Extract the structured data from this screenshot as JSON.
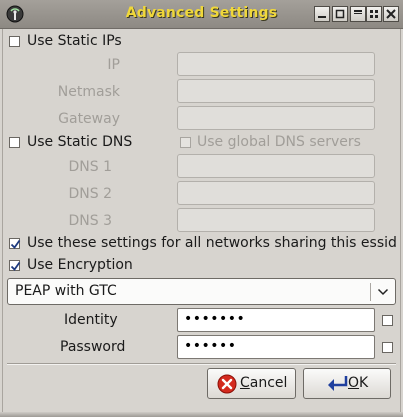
{
  "window": {
    "title": "Advanced Settings"
  },
  "static_ips": {
    "label": "Use Static IPs",
    "checked": false,
    "fields": [
      {
        "label": "IP",
        "value": ""
      },
      {
        "label": "Netmask",
        "value": ""
      },
      {
        "label": "Gateway",
        "value": ""
      }
    ]
  },
  "static_dns": {
    "label": "Use Static DNS",
    "checked": false,
    "global_label": "Use global DNS servers",
    "global_checked": false,
    "fields": [
      {
        "label": "DNS 1",
        "value": ""
      },
      {
        "label": "DNS 2",
        "value": ""
      },
      {
        "label": "DNS 3",
        "value": ""
      }
    ]
  },
  "essid_option": {
    "label": "Use these settings for all networks sharing this essid",
    "checked": true
  },
  "encryption": {
    "label": "Use Encryption",
    "checked": true,
    "method": "PEAP with GTC"
  },
  "credentials": {
    "identity_label": "Identity",
    "identity_value": "•••••••",
    "identity_show_checked": false,
    "password_label": "Password",
    "password_value": "••••••",
    "password_show_checked": false
  },
  "buttons": {
    "cancel_mnemonic": "C",
    "cancel_rest": "ancel",
    "ok_mnemonic": "O",
    "ok_rest": "K"
  }
}
